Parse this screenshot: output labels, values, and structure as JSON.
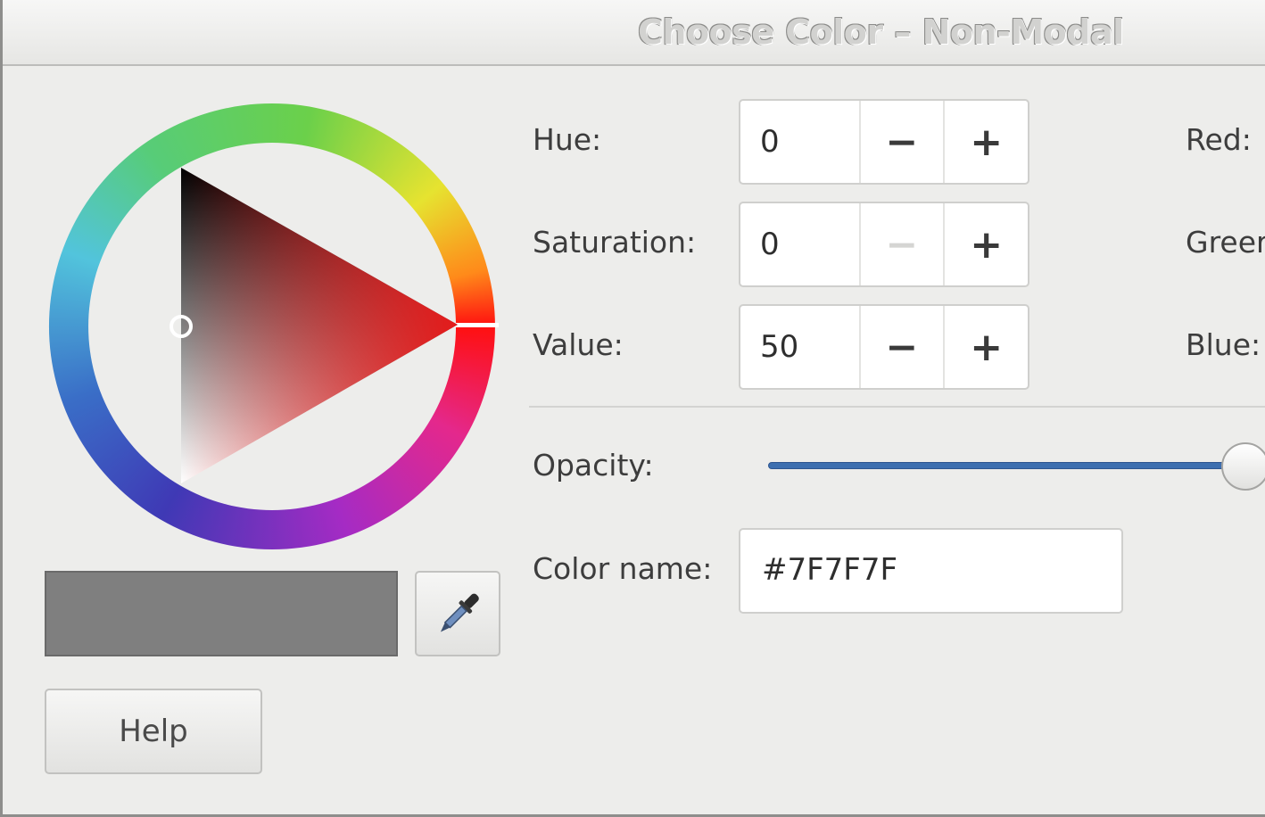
{
  "window": {
    "title": "Choose Color – Non-Modal"
  },
  "hsv": {
    "hue": {
      "label": "Hue:",
      "value": "0",
      "decrement": "−",
      "increment": "+"
    },
    "saturation": {
      "label": "Saturation:",
      "value": "0",
      "decrement": "−",
      "increment": "+",
      "decrement_disabled": true
    },
    "value": {
      "label": "Value:",
      "value": "50",
      "decrement": "−",
      "increment": "+"
    }
  },
  "rgb": {
    "red_label": "Red:",
    "green_label": "Greer",
    "blue_label": "Blue:"
  },
  "opacity": {
    "label": "Opacity:",
    "level_fraction": 1.0
  },
  "color_name": {
    "label": "Color name:",
    "value": "#7F7F7F"
  },
  "current_color": {
    "hex": "#7F7F7F"
  },
  "help_button": {
    "label": "Help"
  },
  "icons": {
    "color_picker": "eyedropper-icon"
  }
}
